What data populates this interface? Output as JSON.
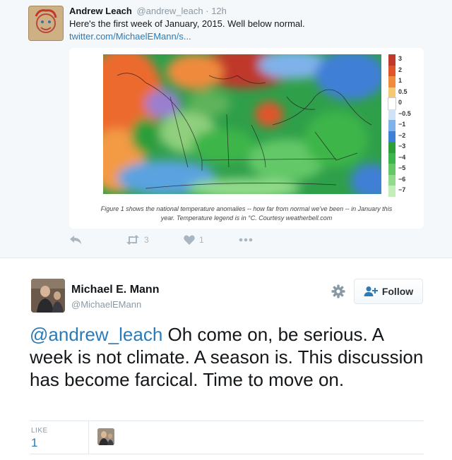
{
  "quoted_tweet": {
    "name": "Andrew Leach",
    "handle": "@andrew_leach",
    "time": "· 12h",
    "text": "Here's the first week of January, 2015. Well below normal.",
    "link": "twitter.com/MichaelEMann/s...",
    "caption_line1": "Figure 1 shows the national temperature anomalies -- how far from normal we've been -- in January this",
    "caption_line2": "year. Temperature legend is in °C. Courtesy weatherbell.com",
    "legend_labels": [
      "3",
      "2",
      "1",
      "0.5",
      "0",
      "−0.5",
      "−1",
      "−2",
      "−3",
      "−4",
      "−5",
      "−6",
      "−7"
    ],
    "legend_colors": [
      "#c0392b",
      "#e0542a",
      "#f08a3c",
      "#f7c873",
      "#ffffff",
      "#cfe2f7",
      "#7fb2ea",
      "#3f7fd6",
      "#2c9e3a",
      "#3cb54a",
      "#64c867",
      "#93db8c",
      "#c4eeb9"
    ],
    "retweets": "3",
    "likes": "1"
  },
  "main_tweet": {
    "name": "Michael E. Mann",
    "handle": "@MichaelEMann",
    "follow_label": "Follow",
    "mention": "@andrew_leach",
    "text": " Oh come on, be serious. A week is not climate. A season is. This discussion has become farcical. Time to move on.",
    "like_label": "LIKE",
    "like_count": "1"
  },
  "colors": {
    "link": "#2b7bb9",
    "muted": "#8899a6",
    "quoted_background": "#f5f8fa"
  }
}
